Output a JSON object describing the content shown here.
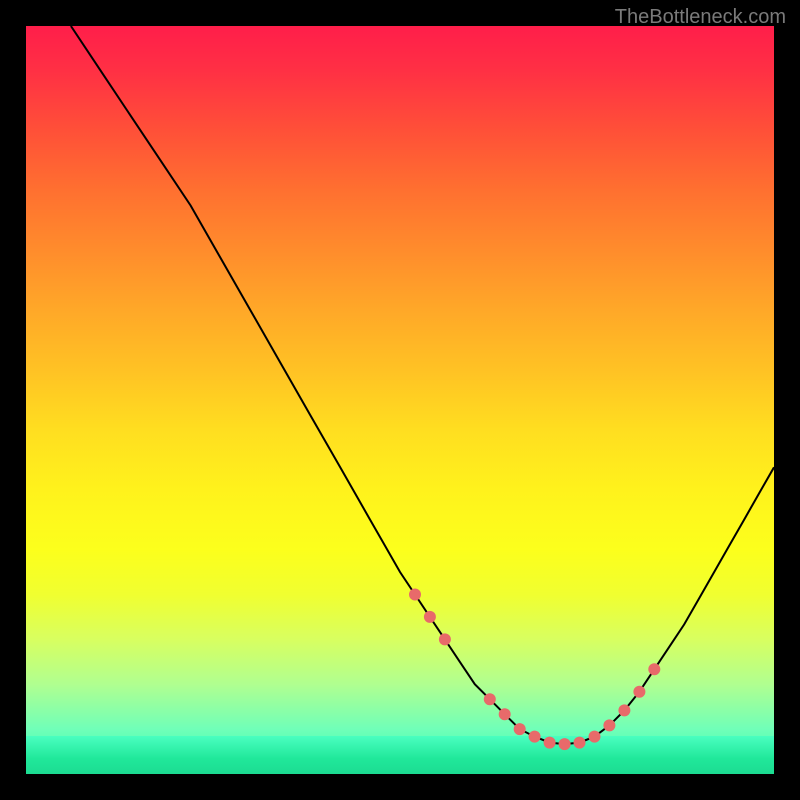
{
  "watermark": "TheBottleneck.com",
  "chart_data": {
    "type": "line",
    "title": "",
    "xlabel": "",
    "ylabel": "",
    "xlim": [
      0,
      100
    ],
    "ylim": [
      0,
      100
    ],
    "series": [
      {
        "name": "curve",
        "x": [
          6,
          10,
          14,
          18,
          22,
          26,
          30,
          34,
          38,
          42,
          46,
          50,
          52,
          54,
          56,
          58,
          60,
          62,
          64,
          66,
          68,
          70,
          72,
          74,
          76,
          78,
          80,
          82,
          84,
          86,
          88,
          90,
          92,
          94,
          96,
          98,
          100
        ],
        "y": [
          100,
          94,
          88,
          82,
          76,
          69,
          62,
          55,
          48,
          41,
          34,
          27,
          24,
          21,
          18,
          15,
          12,
          10,
          8,
          6,
          5,
          4.2,
          4,
          4.2,
          5,
          6.5,
          8.5,
          11,
          14,
          17,
          20,
          23.5,
          27,
          30.5,
          34,
          37.5,
          41
        ]
      }
    ],
    "markers": {
      "name": "highlighted-points",
      "x": [
        52,
        54,
        56,
        62,
        64,
        66,
        68,
        70,
        72,
        74,
        76,
        78,
        80,
        82,
        84
      ],
      "y": [
        24,
        21,
        18,
        10,
        8,
        6,
        5,
        4.2,
        4,
        4.2,
        5,
        6.5,
        8.5,
        11,
        14
      ]
    }
  }
}
